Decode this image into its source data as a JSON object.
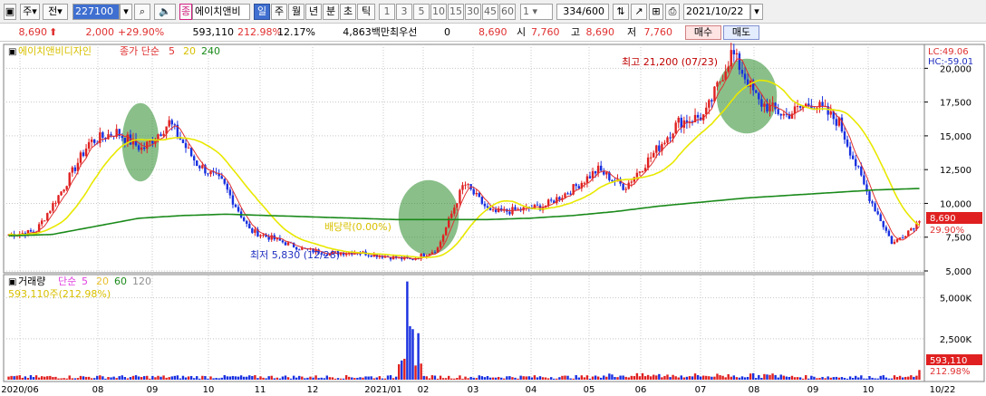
{
  "toolbar": {
    "period_label": "주",
    "prev_label": "전",
    "code_value": "227100",
    "market_badge": "종",
    "stock_name": "에이치앤비",
    "tabs": [
      "일",
      "주",
      "월",
      "년",
      "분",
      "초",
      "틱"
    ],
    "active_tab": 0,
    "periods": [
      "1",
      "3",
      "5",
      "10",
      "15",
      "30",
      "45",
      "60"
    ],
    "spin_value": "1",
    "count_value": "334",
    "count_total": "/600",
    "date_value": "2021/10/22"
  },
  "infobar": {
    "price": "8,690",
    "change": "2,000",
    "change_pct": "+29.90%",
    "volume": "593,110",
    "volume_ratio": "212.98%",
    "turnover": "12.17%",
    "amount": "4,863백만",
    "best_label": "최우선",
    "best_value": "0",
    "last": "8,690",
    "open_label": "시",
    "open": "7,760",
    "high_label": "고",
    "high": "8,690",
    "low_label": "저",
    "low": "7,760",
    "buy_label": "매수",
    "sell_label": "매도"
  },
  "price_panel": {
    "stock_label": "에이치앤비디자인",
    "ma_prefix": "종가 단순",
    "ma_periods": [
      "5",
      "20",
      "240"
    ],
    "ma_colors": [
      "#e03030",
      "#e8e800",
      "#1a8a1a"
    ],
    "lc_label": "LC:49.06",
    "hc_label": "HC:-59.01",
    "high_annotation": "최고 21,200 (07/23)",
    "low_annotation": "최저 5,830 (12/28)",
    "dividend_annotation": "배당락(0.00%)",
    "price_tag": "8,690",
    "pct_tag": "29.90%",
    "pct_color": "#e03030"
  },
  "volume_panel": {
    "label": "거래량",
    "ma_prefix": "단순",
    "ma_periods": [
      "5",
      "20",
      "60",
      "120"
    ],
    "ma_colors": [
      "#e040e0",
      "#e8c030",
      "#1a8a1a",
      "#909090"
    ],
    "sub_label": "593,110주(212.98%)",
    "volume_tag": "593,110",
    "pct_tag": "212.98%"
  },
  "chart_data": [
    {
      "type": "line",
      "title": "에이치앤비디자인",
      "y_axis_ticks": [
        "5,000",
        "7,500",
        "10,000",
        "12,500",
        "15,000",
        "17,500",
        "20,000"
      ],
      "ylim": [
        5000,
        21500
      ],
      "x_tick_labels": [
        "2020/06",
        "08",
        "09",
        "10",
        "11",
        "12",
        "2021/01",
        "02",
        "03",
        "04",
        "05",
        "06",
        "07",
        "08",
        "09",
        "10",
        "10/22"
      ],
      "series": [
        {
          "name": "종가",
          "values": [
            7700,
            7900,
            11000,
            14500,
            15300,
            14000,
            16000,
            13000,
            11500,
            8000,
            7300,
            6600,
            6300,
            6400,
            6100,
            5830,
            6600,
            11500,
            9300,
            9500,
            9800,
            11000,
            12500,
            11200,
            13500,
            16000,
            16500,
            21200,
            17500,
            16500,
            17500,
            16000,
            11000,
            7000,
            8690
          ]
        },
        {
          "name": "240",
          "values": [
            7600,
            7700,
            8300,
            8900,
            9100,
            9200,
            9100,
            9000,
            8900,
            8800,
            8800,
            8800,
            8900,
            9100,
            9400,
            9800,
            10100,
            10400,
            10600,
            10800,
            11000,
            11100
          ]
        }
      ],
      "high": {
        "date": "07/23",
        "value": 21200
      },
      "low": {
        "date": "12/28",
        "value": 5830
      },
      "last": 8690
    },
    {
      "type": "bar",
      "title": "거래량",
      "y_axis_ticks": [
        "2,500K",
        "5,000K"
      ],
      "ylim": [
        0,
        6200000
      ],
      "last_volume": 593110,
      "peak_volume": 6000000
    }
  ]
}
